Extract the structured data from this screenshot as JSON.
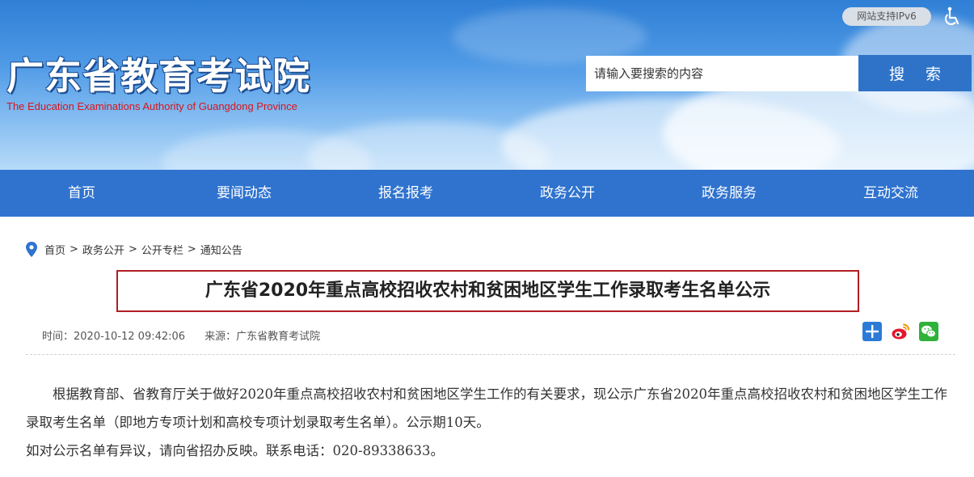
{
  "header": {
    "site_title": "广东省教育考试院",
    "site_subtitle": "The Education Examinations Authority of Guangdong Province",
    "ipv6_badge": "网站支持IPv6",
    "accessibility_icon": "wheelchair-icon",
    "search": {
      "placeholder": "请输入要搜索的内容",
      "button_label": "搜 索"
    }
  },
  "nav": {
    "items": [
      "首页",
      "要闻动态",
      "报名报考",
      "政务公开",
      "政务服务",
      "互动交流"
    ]
  },
  "breadcrumb": {
    "icon": "location-pin-icon",
    "items": [
      "首页",
      "政务公开",
      "公开专栏",
      "通知公告"
    ],
    "separator": ">"
  },
  "article": {
    "title": "广东省2020年重点高校招收农村和贫困地区学生工作录取考生名单公示",
    "time": "时间：2020-10-12 09:42:06",
    "source": "来源：广东省教育考试院",
    "share_icons": [
      "share-plus-icon",
      "weibo-icon",
      "wechat-icon"
    ],
    "paragraphs": [
      "根据教育部、省教育厅关于做好2020年重点高校招收农村和贫困地区学生工作的有关要求，现公示广东省2020年重点高校招收农村和贫困地区学生工作录取考生名单（即地方专项计划和高校专项计划录取考生名单）。公示期10天。",
      "如对公示名单有异议，请向省招办反映。联系电话：020-89338633。"
    ]
  },
  "colors": {
    "nav_bg": "#2f73cf",
    "search_button_bg": "#2f73c9",
    "subtitle_red": "#d8141c",
    "title_border": "#b21d24"
  }
}
